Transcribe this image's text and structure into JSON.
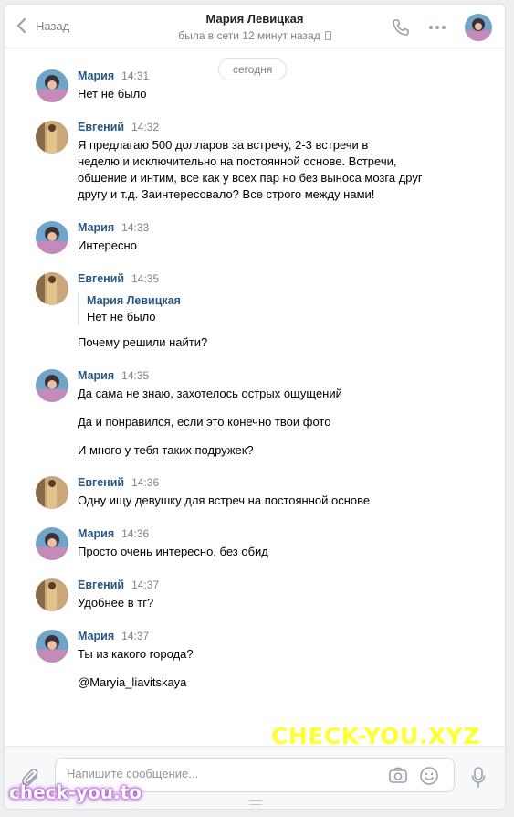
{
  "header": {
    "back_label": "Назад",
    "name": "Мария Левицкая",
    "status": "была в сети 12 минут назад"
  },
  "day_separator": "сегодня",
  "messages": [
    {
      "author": "Мария",
      "time": "14:31",
      "lines": [
        "Нет не было"
      ]
    },
    {
      "author": "Евгений",
      "time": "14:32",
      "lines": [
        "Я предлагаю 500 долларов за встречу, 2-3 встречи в\nнеделю и исключительно на постоянной основе. Встречи,\nобщение и интим, все как у всех пар но без выноса мозга друг\nдругу и т.д. Заинтересовало? Все строго между нами!"
      ]
    },
    {
      "author": "Мария",
      "time": "14:33",
      "lines": [
        "Интересно"
      ]
    },
    {
      "author": "Евгений",
      "time": "14:35",
      "quote": {
        "author": "Мария Левицкая",
        "text": "Нет не было"
      },
      "lines": [
        "Почему решили найти?"
      ]
    },
    {
      "author": "Мария",
      "time": "14:35",
      "lines": [
        "Да сама не знаю, захотелось острых ощущений",
        "Да и понравился, если это конечно твои фото",
        "И много у тебя таких подружек?"
      ]
    },
    {
      "author": "Евгений",
      "time": "14:36",
      "lines": [
        "Одну ищу девушку для встреч на постоянной основе"
      ]
    },
    {
      "author": "Мария",
      "time": "14:36",
      "lines": [
        "Просто очень интересно, без обид"
      ]
    },
    {
      "author": "Евгений",
      "time": "14:37",
      "lines": [
        "Удобнее в тг?"
      ]
    },
    {
      "author": "Мария",
      "time": "14:37",
      "lines": [
        "Ты из какого города?",
        "@Maryia_liavitskaya"
      ]
    }
  ],
  "composer": {
    "placeholder": "Напишите сообщение..."
  },
  "watermarks": {
    "large": "CHECK-YOU.XYZ",
    "small": "check-you.to"
  },
  "colors": {
    "author": "#2a5885",
    "muted": "#828282",
    "icon": "#99a2ad",
    "watermark_large": "#ffff33"
  }
}
